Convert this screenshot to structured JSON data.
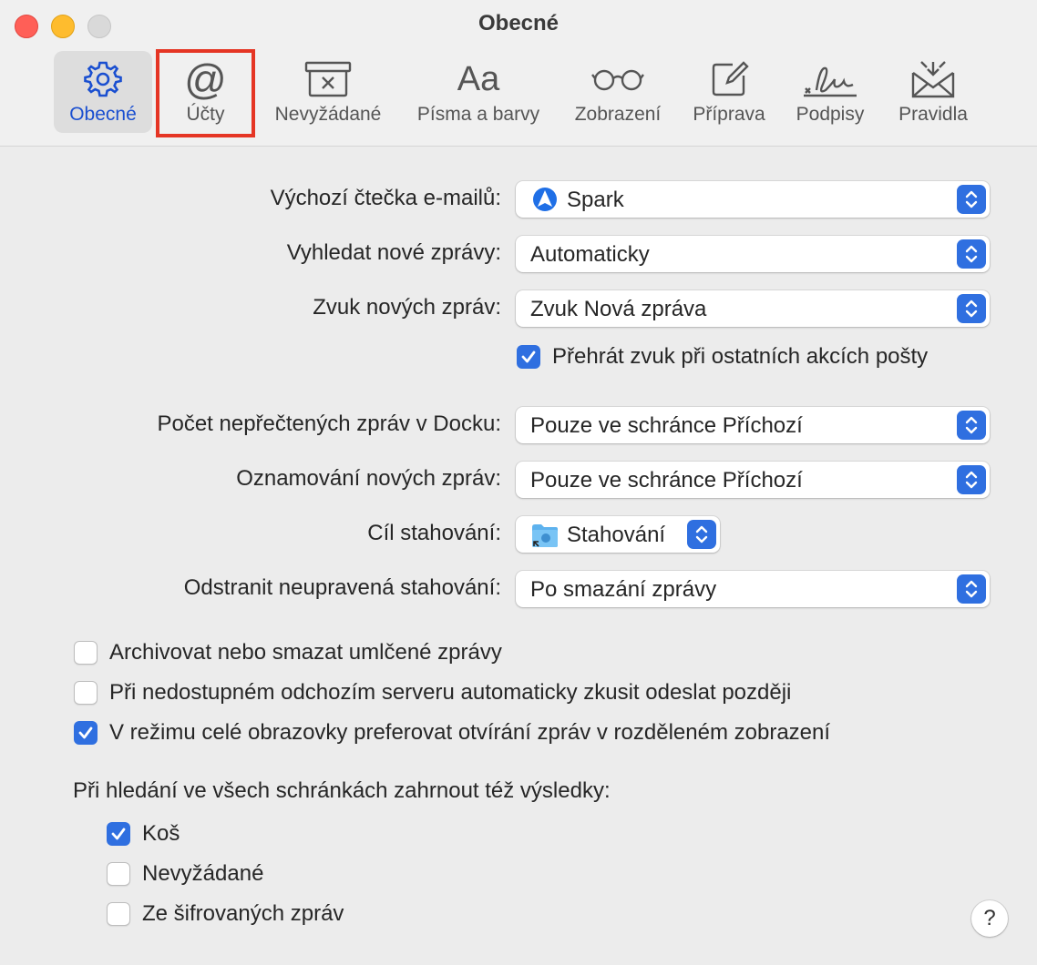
{
  "window": {
    "title": "Obecné"
  },
  "toolbar": {
    "items": [
      {
        "label": "Obecné",
        "icon": "gear-icon",
        "active": true
      },
      {
        "label": "Účty",
        "icon": "at-sign-icon",
        "active": false
      },
      {
        "label": "Nevyžádané",
        "icon": "junk-tray-icon",
        "active": false
      },
      {
        "label": "Písma a barvy",
        "icon": "fonts-icon",
        "active": false
      },
      {
        "label": "Zobrazení",
        "icon": "glasses-icon",
        "active": false
      },
      {
        "label": "Příprava",
        "icon": "compose-icon",
        "active": false
      },
      {
        "label": "Podpisy",
        "icon": "signature-icon",
        "active": false
      },
      {
        "label": "Pravidla",
        "icon": "rules-envelope-icon",
        "active": false
      }
    ],
    "aa_glyph": "Aa",
    "at_glyph": "@"
  },
  "settings": {
    "default_reader": {
      "label": "Výchozí čtečka e-mailů:",
      "value": "Spark"
    },
    "check_new": {
      "label": "Vyhledat nové zprávy:",
      "value": "Automaticky"
    },
    "new_sound": {
      "label": "Zvuk nových zpráv:",
      "value": "Zvuk Nová zpráva"
    },
    "play_sound_other": {
      "label": "Přehrát zvuk při ostatních akcích pošty",
      "checked": true
    },
    "dock_unread": {
      "label": "Počet nepřečtených zpráv v Docku:",
      "value": "Pouze ve schránce Příchozí"
    },
    "notifications": {
      "label": "Oznamování nových zpráv:",
      "value": "Pouze ve schránce Příchozí"
    },
    "download_dest": {
      "label": "Cíl stahování:",
      "value": "Stahování"
    },
    "remove_downloads": {
      "label": "Odstranit neupravená stahování:",
      "value": "Po smazání zprávy"
    }
  },
  "checkboxes": [
    {
      "label": "Archivovat nebo smazat umlčené zprávy",
      "checked": false
    },
    {
      "label": "Při nedostupném odchozím serveru automaticky zkusit odeslat později",
      "checked": false
    },
    {
      "label": "V režimu celé obrazovky preferovat otvírání zpráv v rozděleném zobrazení",
      "checked": true
    }
  ],
  "search_section": {
    "heading": "Při hledání ve všech schránkách zahrnout též výsledky:",
    "options": [
      {
        "label": "Koš",
        "checked": true
      },
      {
        "label": "Nevyžádané",
        "checked": false
      },
      {
        "label": "Ze šifrovaných zpráv",
        "checked": false
      }
    ]
  },
  "help": {
    "label": "?"
  },
  "colors": {
    "accent": "#2f6fe0",
    "highlight_box": "#e53524",
    "active_label": "#1a4fd0"
  }
}
